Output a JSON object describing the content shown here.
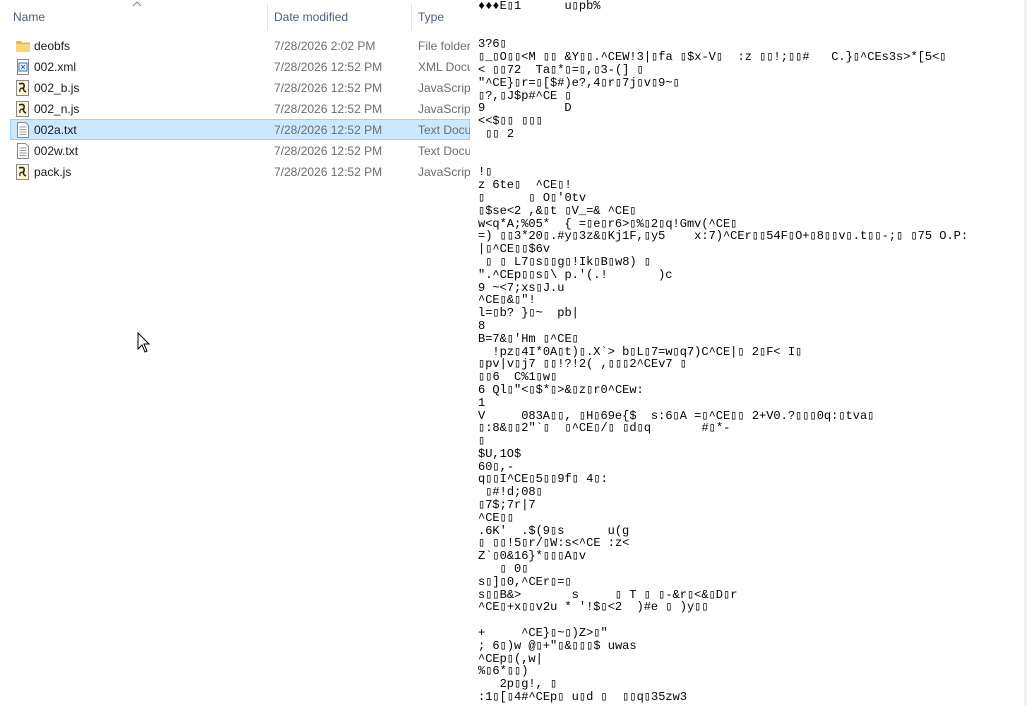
{
  "explorer": {
    "columns": {
      "name": "Name",
      "date": "Date modified",
      "type": "Type"
    },
    "files": [
      {
        "name": "deobfs",
        "date": "7/28/2026 2:02 PM",
        "type": "File folder",
        "icon": "folder-icon",
        "selected": false
      },
      {
        "name": "002.xml",
        "date": "7/28/2026 12:52 PM",
        "type": "XML Document",
        "icon": "xml-file-icon",
        "selected": false
      },
      {
        "name": "002_b.js",
        "date": "7/28/2026 12:52 PM",
        "type": "JavaScript File",
        "icon": "js-file-icon",
        "selected": false
      },
      {
        "name": "002_n.js",
        "date": "7/28/2026 12:52 PM",
        "type": "JavaScript File",
        "icon": "js-file-icon",
        "selected": false
      },
      {
        "name": "002a.txt",
        "date": "7/28/2026 12:52 PM",
        "type": "Text Document",
        "icon": "txt-file-icon",
        "selected": true
      },
      {
        "name": "002w.txt",
        "date": "7/28/2026 12:52 PM",
        "type": "Text Document",
        "icon": "txt-file-icon",
        "selected": false
      },
      {
        "name": "pack.js",
        "date": "7/28/2026 12:52 PM",
        "type": "JavaScript File",
        "icon": "js-file-icon",
        "selected": false
      }
    ]
  },
  "viewer": {
    "lines": [
      "♦♦♦E▯1      u▯pb%",
      "",
      "",
      "3?6▯",
      "▯_▯O▯▯<M ▯▯ &Y▯▯.^CEW!3|▯fa ▯$x-V▯  :z ▯▯!;▯▯#   C.}▯^CEs3s>*[5<▯",
      "< ▯▯72  Ta▯*▯=▯,▯3-(] ▯",
      "\"^CE}▯r=▯[$#)e?,4▯r▯7j▯v▯9~▯",
      "▯?,▯J$p#^CE ▯",
      "9           D",
      "<<$▯▯ ▯▯▯",
      " ▯▯ 2",
      "",
      "",
      "!▯",
      "z 6te▯  ^CE▯!",
      "▯      ▯ O▯'0tv",
      "▯$se<2 ,&▯t ▯V_=& ^CE▯",
      "w<q*A;%05*  { =▯e▯r6>▯%▯2▯q!Gmv(^CE▯",
      "=) ▯▯3*20▯.#y▯3z&▯Kj1F,▯y5    x:7)^CEr▯▯54F▯O+▯8▯▯v▯.t▯▯-;▯ ▯75 O.P:",
      "|▯^CE▯▯$6v",
      " ▯ ▯ L7▯s▯▯g▯!Ik▯B▯w8) ▯",
      "\".^CEp▯▯s▯\\ p.'(.!       )c",
      "9 ~<7;xs▯J.u",
      "^CE▯&▯\"!",
      "l=▯b? }▯~  pb|",
      "8",
      "B=7&▯'Hm ▯^CE▯",
      "  !pz▯4I*0A▯t)▯.X`> b▯L▯7=w▯q7)C^CE|▯ 2▯F< I▯",
      "▯pv|v▯j7 ▯▯!?!2( ,▯▯▯2^CEv7 ▯",
      "▯▯6  C%1▯w▯",
      "6 Ql▯\"<▯$*▯>&▯z▯r0^CEw:",
      "1",
      "V     083A▯▯, ▯H▯69e{$  s:6▯A =▯^CE▯▯ 2+V0.?▯▯▯0q:▯tva▯",
      "▯:8&▯▯2\"`▯  ▯^CE▯/▯ ▯d▯q       #▯*-",
      "▯",
      "$U,1O$",
      "60▯,-",
      "q▯▯I^CE▯5▯▯9f▯ 4▯:",
      " ▯#!d;08▯",
      "▯7$;7r|7",
      "^CE▯▯",
      ".6K'  .$(9▯s      u(g",
      "▯ ▯▯!5▯r/▯W:s<^CE :z<",
      "Z`▯0&16}*▯▯▯A▯v",
      "   ▯ 0▯",
      "s▯]▯0,^CEr▯=▯",
      "s▯▯B&>       s     ▯ T ▯ ▯-&r▯<&▯D▯r",
      "^CE▯+x▯▯v2u * '!$▯<2  )#e ▯ )y▯▯",
      "",
      "+     ^CE}▯~▯)Z>▯\"",
      "; 6▯)w @▯+\"▯&▯▯▯$ uwas",
      "^CEp▯(,w|",
      "%▯6*▯▯)",
      "   2p▯g!, ▯",
      ":1▯[▯4#^CEp▯ u▯d ▯  ▯▯q▯35zw3"
    ]
  }
}
